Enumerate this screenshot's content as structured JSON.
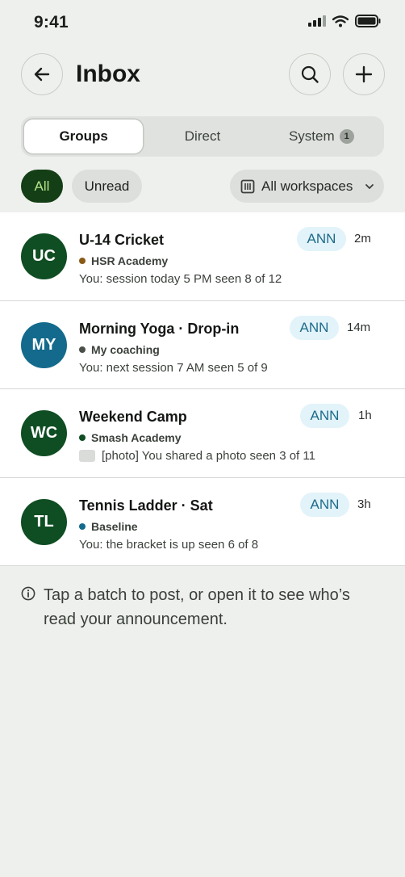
{
  "status_bar": {
    "time": "9:41"
  },
  "header": {
    "title": "Inbox"
  },
  "tabs": [
    {
      "label": "Groups",
      "active": true
    },
    {
      "label": "Direct",
      "active": false
    },
    {
      "label": "System",
      "active": false,
      "badge": "1"
    }
  ],
  "filters": {
    "all_label": "All",
    "unread_label": "Unread",
    "workspace_label": "All workspaces"
  },
  "conversations": [
    {
      "initials": "UC",
      "avatar_color": "#0f4d23",
      "title": "U-14 Cricket",
      "org": "HSR Academy",
      "org_color": "#8a5a16",
      "preview": "You: session today 5 PM  seen 8 of 12",
      "tag": "ANN",
      "time": "2m"
    },
    {
      "initials": "MY",
      "avatar_color": "#136a8c",
      "title": "Morning Yoga · Drop-in",
      "org": "My coaching",
      "org_color": "#4a4f4a",
      "preview": "You: next session 7 AM  seen 5 of 9",
      "tag": "ANN",
      "time": "14m"
    },
    {
      "initials": "WC",
      "avatar_color": "#0f4d23",
      "title": "Weekend Camp",
      "org": "Smash Academy",
      "org_color": "#0f4d23",
      "preview": "[photo] You shared a photo  seen 3 of 11",
      "tag": "ANN",
      "time": "1h"
    },
    {
      "initials": "TL",
      "avatar_color": "#0f4d23",
      "title": "Tennis Ladder · Sat",
      "org": "Baseline",
      "org_color": "#136a8c",
      "preview": "You: the bracket is up  seen 6 of 8",
      "tag": "ANN",
      "time": "3h"
    }
  ],
  "info": {
    "text": "Tap a batch to post, or open it to see who’s read your announcement."
  },
  "colors": {
    "accent_dark": "#143e15",
    "accent_light": "#b7e38d",
    "ann_bg": "#e2f3fa",
    "ann_text": "#1e6b8a"
  }
}
